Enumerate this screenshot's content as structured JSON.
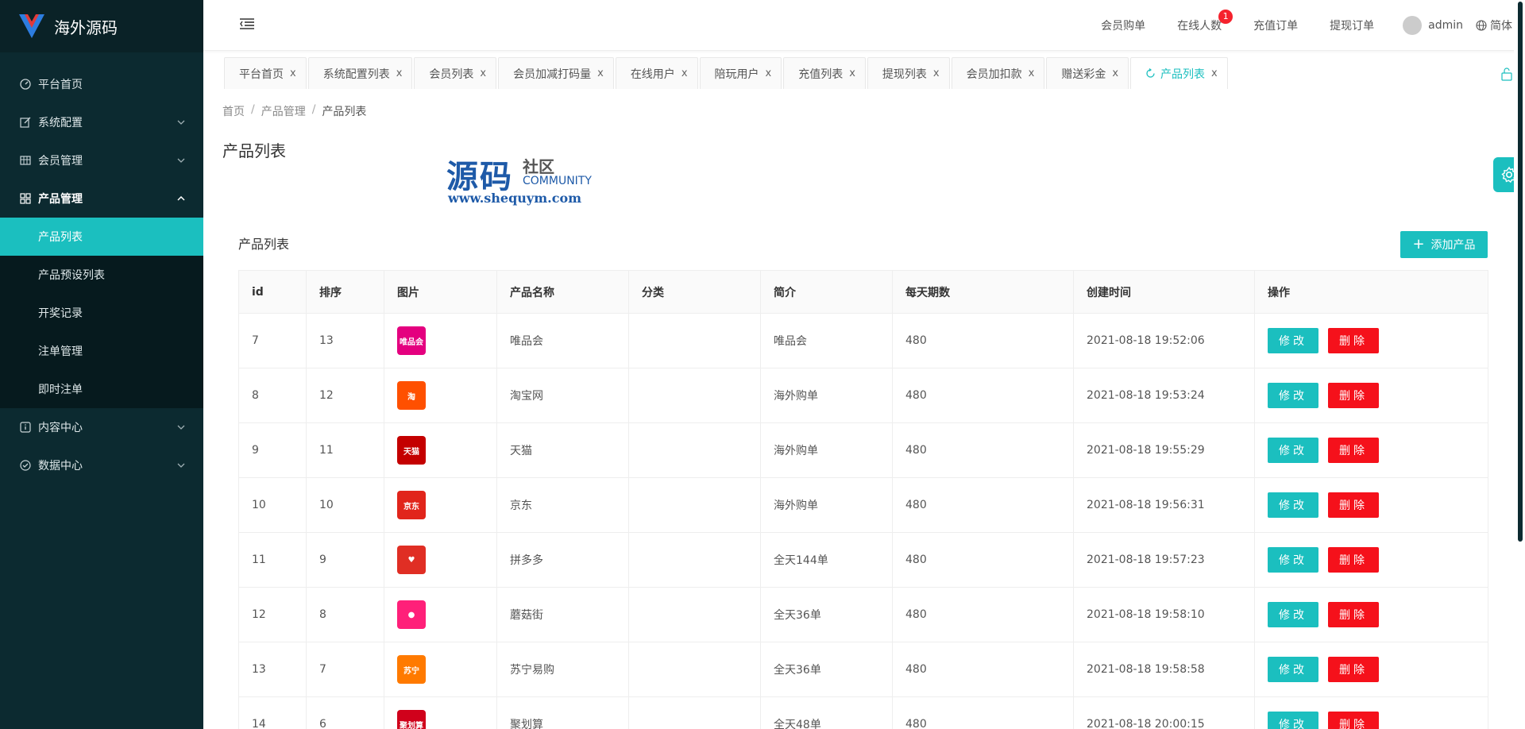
{
  "app": {
    "title": "海外源码"
  },
  "sidebar": {
    "items": [
      {
        "label": "平台首页",
        "icon": "dashboard-icon"
      },
      {
        "label": "系统配置",
        "icon": "edit-icon"
      },
      {
        "label": "会员管理",
        "icon": "table-icon"
      },
      {
        "label": "产品管理",
        "icon": "grid-icon"
      },
      {
        "label": "内容中心",
        "icon": "info-circle-icon"
      },
      {
        "label": "数据中心",
        "icon": "check-circle-icon"
      }
    ],
    "sub_items": [
      {
        "label": "产品列表",
        "active": true
      },
      {
        "label": "产品预设列表"
      },
      {
        "label": "开奖记录"
      },
      {
        "label": "注单管理"
      },
      {
        "label": "即时注单"
      }
    ]
  },
  "header": {
    "links": [
      "会员购单",
      "在线人数",
      "充值订单",
      "提现订单"
    ],
    "online_badge": "1",
    "user": "admin",
    "language": "简体"
  },
  "tabs": [
    {
      "label": "平台首页"
    },
    {
      "label": "系统配置列表"
    },
    {
      "label": "会员列表"
    },
    {
      "label": "会员加减打码量"
    },
    {
      "label": "在线用户"
    },
    {
      "label": "陪玩用户"
    },
    {
      "label": "充值列表"
    },
    {
      "label": "提现列表"
    },
    {
      "label": "会员加扣款"
    },
    {
      "label": "赠送彩金"
    },
    {
      "label": "产品列表",
      "active": true
    }
  ],
  "tab_close": "x",
  "breadcrumb": [
    "首页",
    "产品管理",
    "产品列表"
  ],
  "page": {
    "title": "产品列表",
    "card_title": "产品列表",
    "add_button": "添加产品"
  },
  "watermark": {
    "big": "源码",
    "small": "社区",
    "community": "COMMUNITY",
    "url": "www.shequym.com"
  },
  "table": {
    "headers": [
      "id",
      "排序",
      "图片",
      "产品名称",
      "分类",
      "简介",
      "每天期数",
      "创建时间",
      "操作"
    ],
    "edit_label": "修改",
    "delete_label": "删除",
    "rows": [
      {
        "id": "7",
        "sort": "13",
        "thumb_text": "唯品会",
        "thumb_color": "#e4007f",
        "name": "唯品会",
        "category": "",
        "intro": "唯品会",
        "periods": "480",
        "created": "2021-08-18 19:52:06"
      },
      {
        "id": "8",
        "sort": "12",
        "thumb_text": "淘",
        "thumb_color": "#ff5000",
        "name": "淘宝网",
        "category": "",
        "intro": "海外购单",
        "periods": "480",
        "created": "2021-08-18 19:53:24"
      },
      {
        "id": "9",
        "sort": "11",
        "thumb_text": "天猫",
        "thumb_color": "#c40000",
        "name": "天猫",
        "category": "",
        "intro": "海外购单",
        "periods": "480",
        "created": "2021-08-18 19:55:29"
      },
      {
        "id": "10",
        "sort": "10",
        "thumb_text": "京东",
        "thumb_color": "#e1251b",
        "name": "京东",
        "category": "",
        "intro": "海外购单",
        "periods": "480",
        "created": "2021-08-18 19:56:31"
      },
      {
        "id": "11",
        "sort": "9",
        "thumb_text": "♥",
        "thumb_color": "#e02e24",
        "name": "拼多多",
        "category": "",
        "intro": "全天144单",
        "periods": "480",
        "created": "2021-08-18 19:57:23"
      },
      {
        "id": "12",
        "sort": "8",
        "thumb_text": "●",
        "thumb_color": "#ff2079",
        "name": "蘑菇街",
        "category": "",
        "intro": "全天36单",
        "periods": "480",
        "created": "2021-08-18 19:58:10"
      },
      {
        "id": "13",
        "sort": "7",
        "thumb_text": "苏宁",
        "thumb_color": "#ff7a00",
        "name": "苏宁易购",
        "category": "",
        "intro": "全天36单",
        "periods": "480",
        "created": "2021-08-18 19:58:58"
      },
      {
        "id": "14",
        "sort": "6",
        "thumb_text": "聚划算",
        "thumb_color": "#d0011b",
        "name": "聚划算",
        "category": "",
        "intro": "全天48单",
        "periods": "480",
        "created": "2021-08-18 20:00:15"
      }
    ]
  },
  "colors": {
    "accent": "#1bbfbf",
    "danger": "#f5111b",
    "sidebar_bg": "#0c2a30"
  }
}
